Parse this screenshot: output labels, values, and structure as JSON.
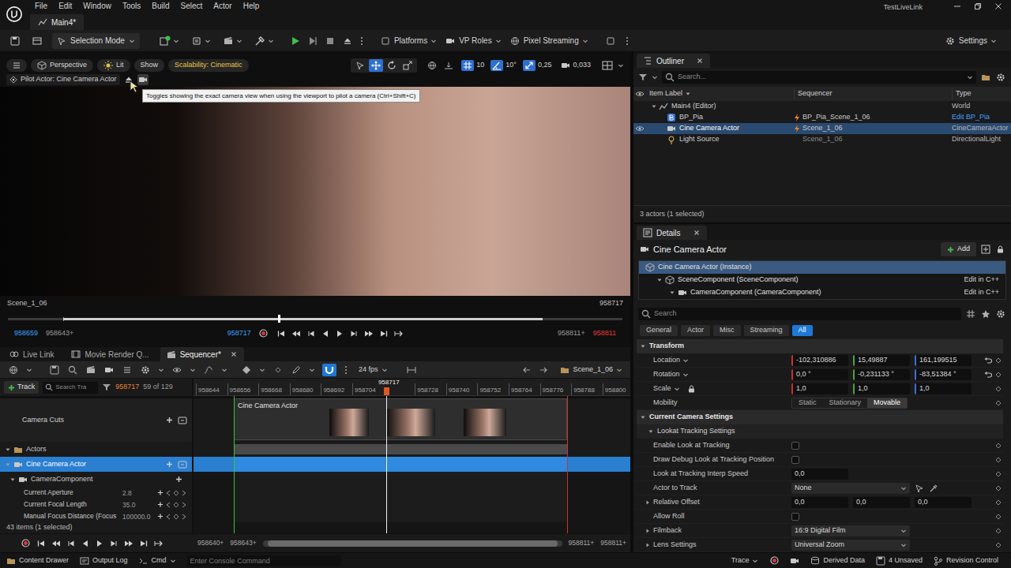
{
  "title_bar": {
    "menu": [
      "File",
      "Edit",
      "Window",
      "Tools",
      "Build",
      "Select",
      "Actor",
      "Help"
    ],
    "project": "TestLiveLink",
    "level_tab": "Main4*"
  },
  "toolbar": {
    "mode": "Selection Mode",
    "menus": [
      "Platforms",
      "VP Roles",
      "Pixel Streaming"
    ],
    "settings": "Settings"
  },
  "viewport": {
    "view_menus": [
      "Perspective",
      "Lit",
      "Show"
    ],
    "scalability": "Scalability: Cinematic",
    "tools": [
      {
        "kind": "select",
        "selected": false
      },
      {
        "kind": "move",
        "selected": true
      },
      {
        "kind": "rotate",
        "selected": false
      },
      {
        "kind": "scale",
        "selected": false
      }
    ],
    "snaps": [
      {
        "kind": "grid",
        "value": "10",
        "on": true
      },
      {
        "kind": "angle",
        "value": "10°",
        "on": true
      },
      {
        "kind": "scale",
        "value": "0,25",
        "on": true
      }
    ],
    "camera_speed": "0,033",
    "pilot": "Pilot Actor: Cine Camera Actor",
    "exact_camera_view": true,
    "tooltip": "Toggles showing the exact camera view when using the viewport to pilot a camera (Ctrl+Shift+C)",
    "shot": "Scene_1_06",
    "frame": "958717",
    "range_start": 0.09,
    "range_end": 0.87,
    "scrub_level": 0.44,
    "start": "958659",
    "start_bound": "958643+",
    "current": "958717",
    "end_bound": "958811+",
    "end": "958811"
  },
  "panel_tabs": [
    {
      "label": "Live Link",
      "selected": false
    },
    {
      "label": "Movie Render Q...",
      "selected": false
    },
    {
      "label": "Sequencer*",
      "selected": true
    }
  ],
  "sequencer": {
    "fps": "24 fps",
    "sequence": "Scene_1_06",
    "snap": true,
    "add_track": "Track",
    "search_placeholder": "Search Tra",
    "current_frame": "958717",
    "key_info": "59 of 129",
    "ruler": [
      "958644",
      "958656",
      "958668",
      "958680",
      "958692",
      "958704",
      "958728",
      "958740",
      "958752",
      "958764",
      "958776",
      "958788",
      "958800"
    ],
    "playhead": "958717",
    "clip": "Cine Camera Actor",
    "tracks": [
      {
        "label": "Camera Cuts",
        "kind": "cuts",
        "selected": false
      },
      {
        "label": "Actors",
        "kind": "folder",
        "selected": false,
        "expanded": true
      },
      {
        "label": "Cine Camera Actor",
        "kind": "actor",
        "selected": true,
        "expanded": true
      },
      {
        "label": "CameraComponent",
        "kind": "component",
        "selected": false,
        "expanded": true
      },
      {
        "label": "Current Aperture",
        "kind": "property",
        "value": "2.8",
        "selected": false
      },
      {
        "label": "Current Focal Length",
        "kind": "property",
        "value": "35.0",
        "selected": false
      },
      {
        "label": "Manual Focus Distance (Focus",
        "kind": "property",
        "value": "100000.0",
        "selected": false
      }
    ],
    "items_count": "43 items (1 selected)",
    "view_start": "958640+",
    "view_start_bound": "958643+",
    "view_end_bound": "958811+",
    "view_end": "958811+"
  },
  "outliner": {
    "title": "Outliner",
    "search_placeholder": "Search...",
    "columns": [
      "Item Label",
      "Sequencer",
      "Type"
    ],
    "rows": [
      {
        "label": "Main4 (Editor)",
        "kind": "world",
        "depth": 0,
        "type": "World",
        "type_link": false,
        "selected": false,
        "visible": false,
        "expanded": true
      },
      {
        "label": "BP_Pia",
        "kind": "blueprint",
        "depth": 1,
        "sequencer": "BP_Pia_Scene_1_06",
        "bound": true,
        "type": "Edit BP_Pia",
        "type_link": true,
        "selected": false,
        "visible": false
      },
      {
        "label": "Cine Camera Actor",
        "kind": "camera",
        "depth": 1,
        "sequencer": "Scene_1_06",
        "bound": true,
        "type": "CineCameraActor",
        "type_link": false,
        "selected": true,
        "visible": true
      },
      {
        "label": "Light Source",
        "kind": "light",
        "depth": 1,
        "sequencer": "Scene_1_06",
        "bound": false,
        "type": "DirectionalLight",
        "type_link": false,
        "selected": false,
        "visible": false
      }
    ],
    "footer": "3 actors (1 selected)"
  },
  "details": {
    "title": "Details",
    "actor": "Cine Camera Actor",
    "add": "Add",
    "components": [
      {
        "label": "Cine Camera Actor (Instance)",
        "depth": 0,
        "selected": true
      },
      {
        "label": "SceneComponent (SceneComponent)",
        "depth": 1,
        "action": "Edit in C++",
        "selected": false
      },
      {
        "label": "CameraComponent (CameraComponent)",
        "depth": 2,
        "action": "Edit in C++",
        "selected": false
      }
    ],
    "search_placeholder": "Search",
    "filters": [
      {
        "label": "General",
        "selected": false
      },
      {
        "label": "Actor",
        "selected": false
      },
      {
        "label": "Misc",
        "selected": false
      },
      {
        "label": "Streaming",
        "selected": false
      },
      {
        "label": "All",
        "selected": true
      }
    ],
    "rows": [
      {
        "kind": "section",
        "label": "Transform",
        "expanded": true
      },
      {
        "kind": "vector",
        "label": "Location",
        "dropdown": true,
        "colored": true,
        "values": [
          "-102,310886",
          "15,49887",
          "161,199515"
        ],
        "modified": true
      },
      {
        "kind": "vector",
        "label": "Rotation",
        "dropdown": true,
        "colored": true,
        "values": [
          "0,0 °",
          "-0,231133 °",
          "-83,51384 °"
        ],
        "modified": true
      },
      {
        "kind": "vector",
        "label": "Scale",
        "dropdown": true,
        "colored": true,
        "lock": true,
        "values": [
          "1,0",
          "1,0",
          "1,0"
        ],
        "modified": false
      },
      {
        "kind": "segmented",
        "label": "Mobility",
        "options": [
          {
            "label": "Static",
            "selected": false
          },
          {
            "label": "Stationary",
            "selected": false
          },
          {
            "label": "Movable",
            "selected": true
          }
        ]
      },
      {
        "kind": "section",
        "label": "Current Camera Settings",
        "expanded": true
      },
      {
        "kind": "group",
        "label": "Lookat Tracking Settings",
        "expanded": true
      },
      {
        "kind": "checkbox",
        "label": "Enable Look at Tracking",
        "checked": false
      },
      {
        "kind": "checkbox",
        "label": "Draw Debug Look at Tracking Position",
        "checked": false
      },
      {
        "kind": "number",
        "label": "Look at Tracking Interp Speed",
        "value": "0,0"
      },
      {
        "kind": "actor-picker",
        "label": "Actor to Track",
        "value": "None"
      },
      {
        "kind": "vector",
        "label": "Relative Offset",
        "dropdown": false,
        "colored": false,
        "expanded": false,
        "values": [
          "0,0",
          "0,0",
          "0,0"
        ],
        "modified": false
      },
      {
        "kind": "checkbox",
        "label": "Allow Roll",
        "checked": false
      },
      {
        "kind": "combo",
        "label": "Filmback",
        "value": "16:9 Digital Film",
        "expanded": false
      },
      {
        "kind": "combo",
        "label": "Lens Settings",
        "value": "Universal Zoom",
        "expanded": false
      }
    ]
  },
  "status_bar": {
    "items": [
      "Content Drawer",
      "Output Log"
    ],
    "cmd": "Cmd",
    "console_placeholder": "Enter Console Command",
    "trace": "Trace",
    "derived_data": "Derived Data",
    "unsaved": "4 Unsaved",
    "revision_control": "Revision Control"
  }
}
